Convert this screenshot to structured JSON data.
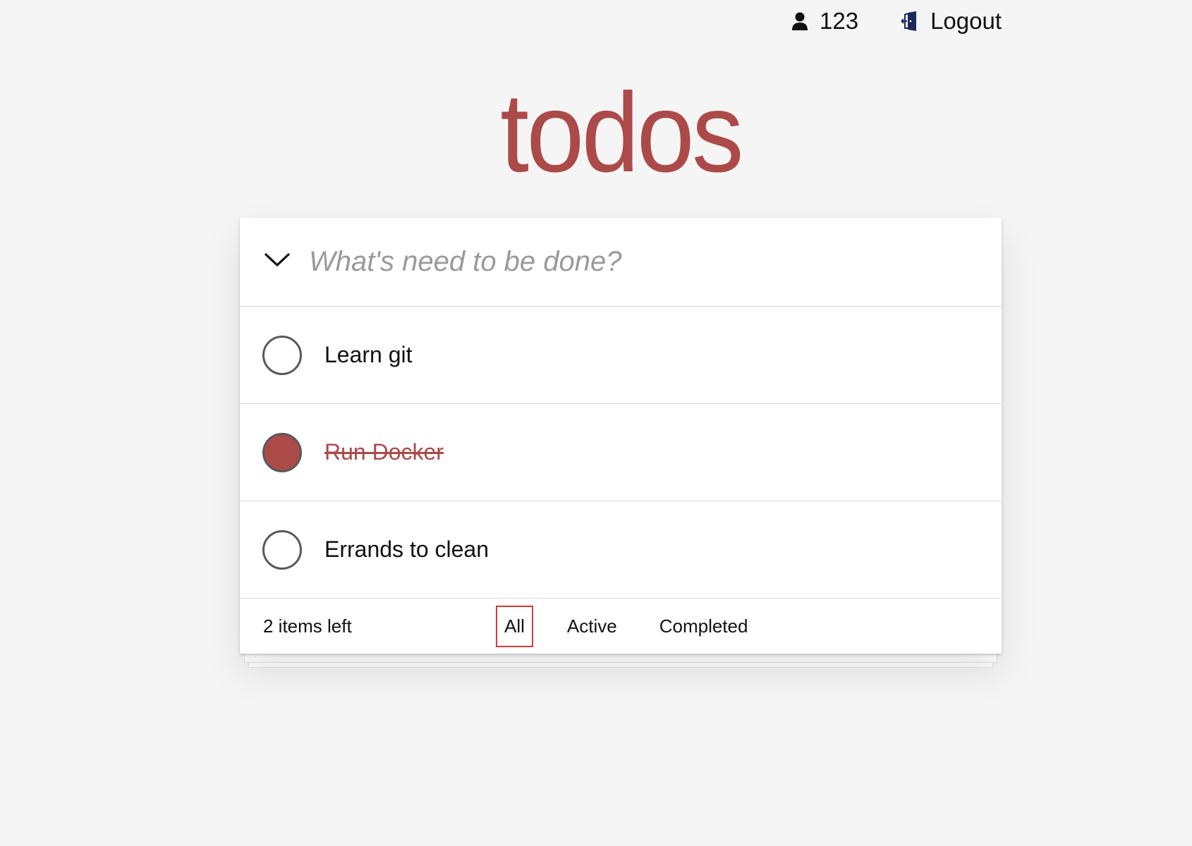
{
  "header": {
    "username": "123",
    "logout_label": "Logout"
  },
  "app": {
    "title": "todos",
    "accent_color": "#ac4a4a"
  },
  "new_todo": {
    "placeholder": "What's need to be done?",
    "value": ""
  },
  "todos": [
    {
      "label": "Learn git",
      "completed": false
    },
    {
      "label": "Run Docker",
      "completed": true
    },
    {
      "label": "Errands to clean",
      "completed": false
    }
  ],
  "footer": {
    "items_left": "2 items left",
    "filters": {
      "all": "All",
      "active": "Active",
      "completed": "Completed"
    },
    "selected_filter": "All",
    "selected_border_color": "#d63a3a"
  }
}
